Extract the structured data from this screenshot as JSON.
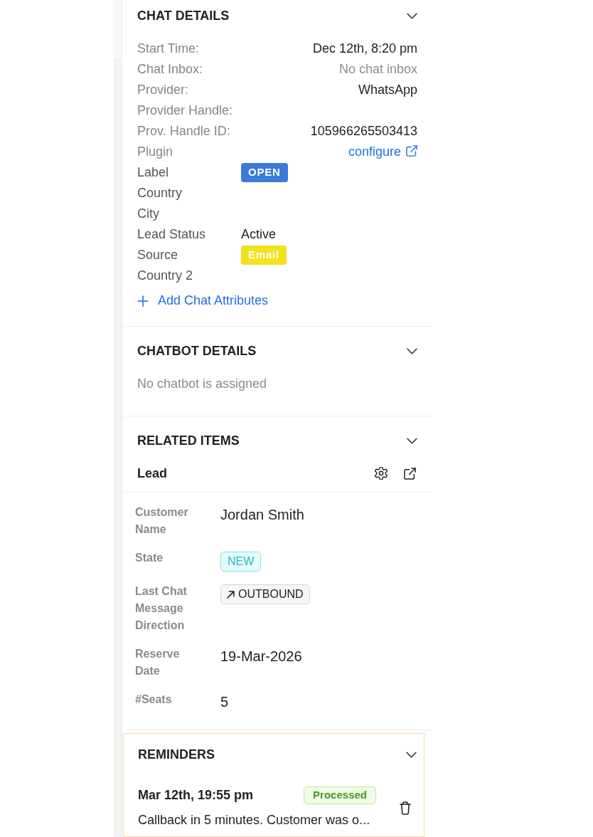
{
  "chat_details": {
    "title": "CHAT DETAILS",
    "fields": [
      {
        "label": "Start Time:",
        "kind": "text",
        "value": "Dec 12th, 8:20 pm"
      },
      {
        "label": "Chat Inbox:",
        "kind": "muted",
        "value": "No chat inbox"
      },
      {
        "label": "Provider:",
        "kind": "text",
        "value": "WhatsApp"
      },
      {
        "label": "Provider Handle:"
      },
      {
        "label": "Prov. Handle ID:",
        "kind": "text",
        "value": "105966265503413"
      },
      {
        "label": "Plugin",
        "kind": "link",
        "value": "configure"
      }
    ],
    "attributes": [
      {
        "label": "Label",
        "kind": "tag",
        "value": "OPEN",
        "color": "#3b7bd8"
      },
      {
        "label": "Country"
      },
      {
        "label": "City"
      },
      {
        "label": "Lead Status",
        "kind": "text",
        "value": "Active"
      },
      {
        "label": "Source",
        "kind": "tag",
        "value": "Email",
        "color": "#f2e21c"
      },
      {
        "label": "Country 2"
      }
    ],
    "add_attributes": "Add Chat Attributes"
  },
  "chatbot_details": {
    "title": "CHATBOT DETAILS",
    "message": "No chatbot is assigned"
  },
  "related_items": {
    "title": "RELATED ITEMS",
    "lead": {
      "title": "Lead",
      "fields": [
        {
          "label": "Customer Name",
          "kind": "text",
          "value": "Jordan Smith"
        },
        {
          "label": "State",
          "kind": "tag",
          "value": "NEW"
        },
        {
          "label": "Last Chat Message Direction",
          "kind": "direction",
          "value": "OUTBOUND"
        },
        {
          "label": "Reserve Date",
          "kind": "text",
          "value": "19-Mar-2026"
        },
        {
          "label": "#Seats",
          "kind": "text",
          "value": "5"
        }
      ]
    }
  },
  "reminders": {
    "title": "REMINDERS",
    "items": [
      {
        "time": "Mar 12th, 19:55 pm",
        "status": "Processed",
        "text": "Callback in 5 minutes. Customer was o..."
      }
    ]
  }
}
